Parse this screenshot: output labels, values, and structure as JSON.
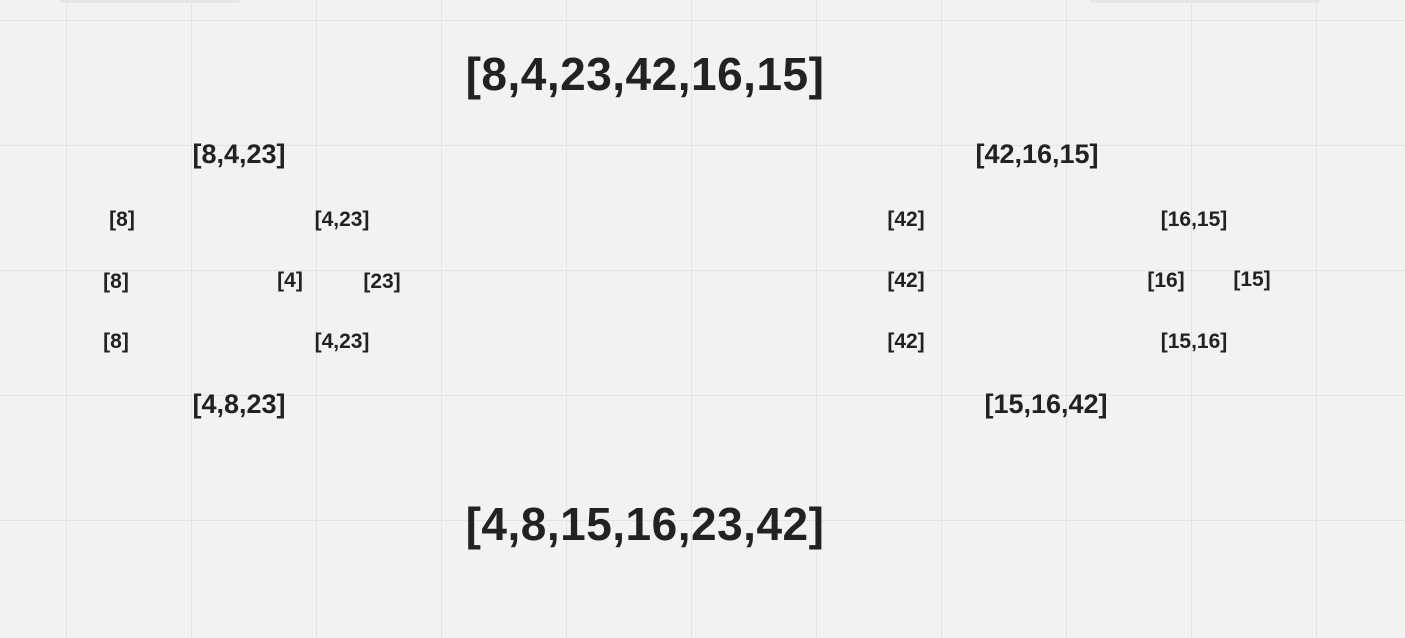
{
  "diagram": {
    "title": "",
    "input_array": "[8,4,23,42,16,15]",
    "split": {
      "left_half": "[8,4,23]",
      "right_half": "[42,16,15]"
    },
    "split_level_2": {
      "left_a": "[8]",
      "left_b": "[4,23]",
      "right_a": "[42]",
      "right_b": "[16,15]"
    },
    "split_level_3": {
      "left_a": "[8]",
      "left_b1": "[4]",
      "left_b2": "[23]",
      "right_a": "[42]",
      "right_b1": "[16]",
      "right_b2": "[15]"
    },
    "merge_level_3": {
      "left_a": "[8]",
      "left_b": "[4,23]",
      "right_a": "[42]",
      "right_b": "[15,16]"
    },
    "merge_level_2": {
      "left_half": "[4,8,23]",
      "right_half": "[15,16,42]"
    },
    "sorted_array": "[4,8,15,16,23,42]"
  },
  "colors": {
    "background": "#f2f2f2",
    "grid_line": "#e4e4e4",
    "text": "#222222"
  }
}
